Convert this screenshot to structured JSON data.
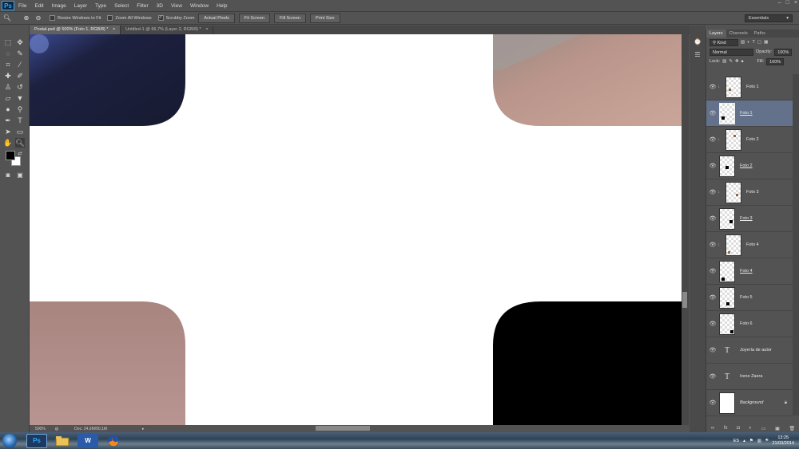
{
  "app": {
    "logo": "Ps"
  },
  "menu": [
    "File",
    "Edit",
    "Image",
    "Layer",
    "Type",
    "Select",
    "Filter",
    "3D",
    "View",
    "Window",
    "Help"
  ],
  "window_controls": [
    "–",
    "□",
    "×"
  ],
  "options_bar": {
    "resize_windows": "Resize Windows to Fit",
    "zoom_all": "Zoom All Windows",
    "scrubby_zoom": "Scrubby Zoom",
    "scrubby_checked": "✓",
    "actual_pixels": "Actual Pixels",
    "fit_screen": "Fit Screen",
    "fill_screen": "Fill Screen",
    "print_size": "Print Size",
    "workspace": "Essentials"
  },
  "tabs": [
    {
      "label": "Postal.psd @ 500% (Foto 1, RGB/8) *",
      "close": "×"
    },
    {
      "label": "Untitled-1 @ 66,7% (Layer 2, RGB/8) *",
      "close": "×"
    }
  ],
  "status": {
    "zoom": "500%",
    "doc": "Doc: 24,9M/90,1M"
  },
  "layers_panel": {
    "tabs": [
      "Layers",
      "Channels",
      "Paths"
    ],
    "kind": "Kind",
    "blend_mode": "Normal",
    "opacity_label": "Opacity:",
    "opacity": "100%",
    "lock_label": "Lock:",
    "fill_label": "Fill:",
    "fill": "100%",
    "layers": [
      {
        "name": "Foto 1",
        "kind": "clipped"
      },
      {
        "name": "Foto 1",
        "kind": "shape"
      },
      {
        "name": "Foto 2",
        "kind": "clipped"
      },
      {
        "name": "Foto 2",
        "kind": "shape"
      },
      {
        "name": "Foto 3",
        "kind": "clipped"
      },
      {
        "name": "Foto 3",
        "kind": "shape"
      },
      {
        "name": "Foto 4",
        "kind": "clipped"
      },
      {
        "name": "Foto 4",
        "kind": "shape"
      },
      {
        "name": "Foto 5",
        "kind": "shape"
      },
      {
        "name": "Foto 6",
        "kind": "shape"
      },
      {
        "name": "Joyería de autor",
        "kind": "text"
      },
      {
        "name": "Irene Zaera",
        "kind": "text"
      },
      {
        "name": "Background",
        "kind": "background"
      }
    ]
  },
  "taskbar": {
    "apps": [
      "Ps",
      "W"
    ],
    "language": "ES",
    "time": "13:25",
    "date": "21/03/2014"
  }
}
